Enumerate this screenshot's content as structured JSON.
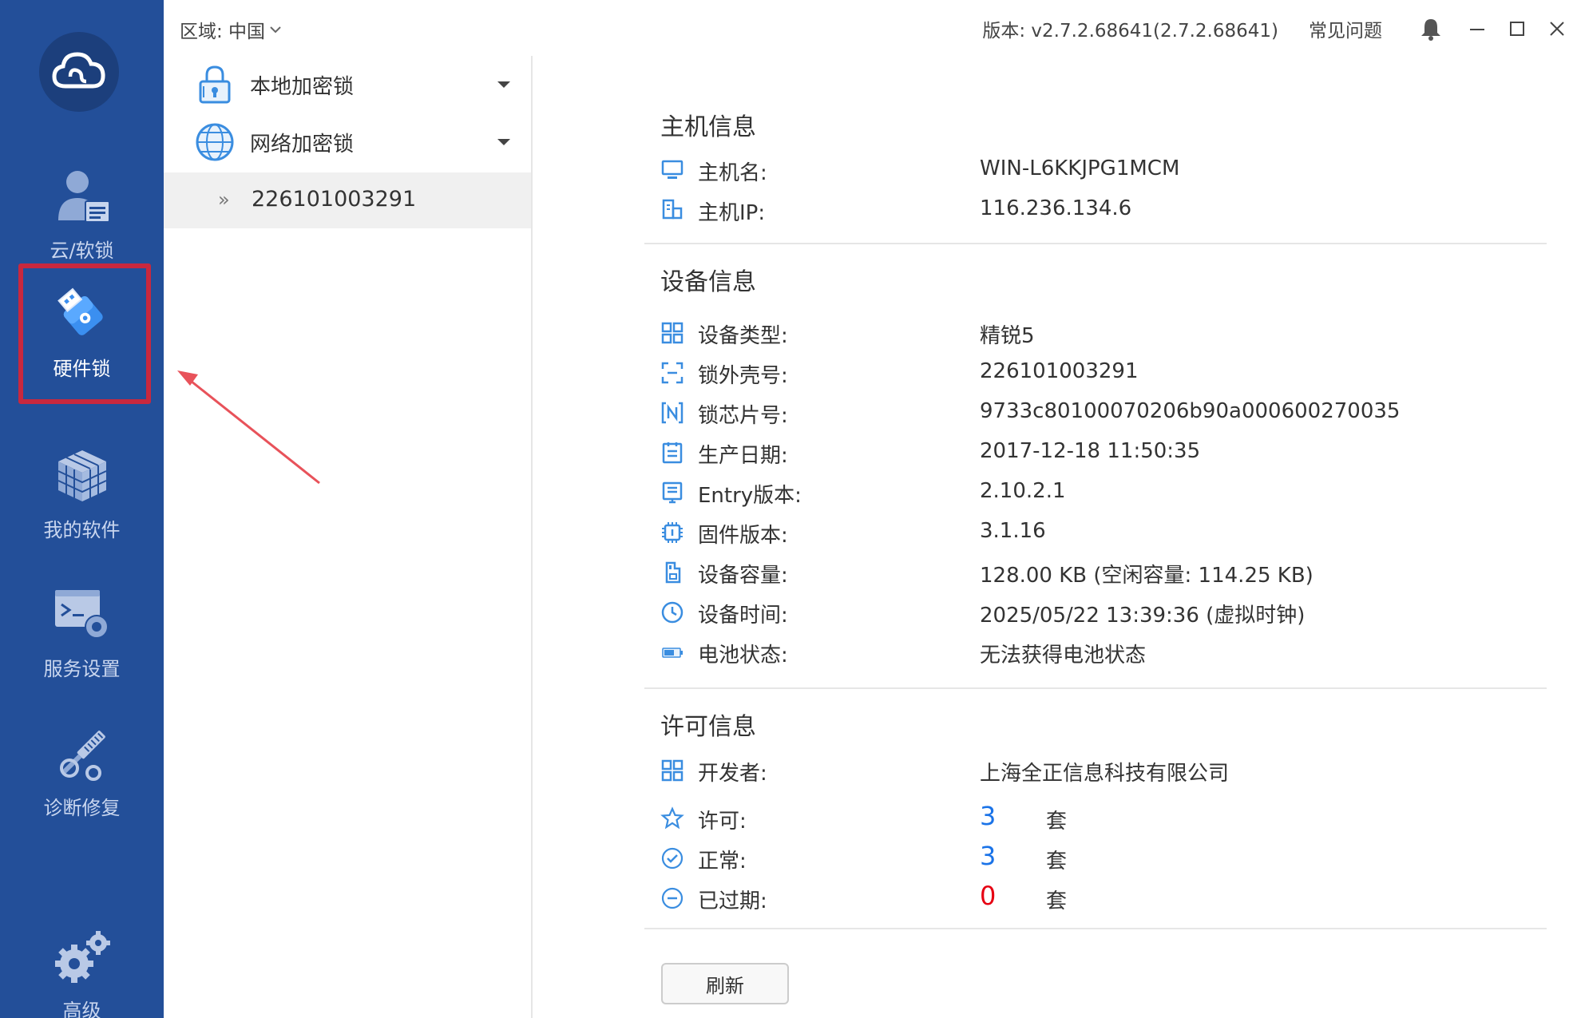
{
  "colors": {
    "sidebar_bg": "#234f99",
    "highlight_border": "#c8283e",
    "accent_blue": "#1a73e8",
    "danger_red": "#e60012",
    "icon_blue": "#3a8de0"
  },
  "sidebar": {
    "logo_icon": "cloud-logo-icon",
    "items": [
      {
        "label": "云/软锁",
        "icon": "user-doc-icon"
      },
      {
        "label": "硬件锁",
        "icon": "usb-key-icon",
        "active": true
      },
      {
        "label": "我的软件",
        "icon": "cube-icon"
      },
      {
        "label": "服务设置",
        "icon": "terminal-gear-icon"
      },
      {
        "label": "诊断修复",
        "icon": "tool-icon"
      },
      {
        "label": "高级",
        "icon": "gears-icon"
      }
    ]
  },
  "topbar": {
    "region_label": "区域: 中国",
    "version": "版本: v2.7.2.68641(2.7.2.68641)",
    "faq": "常见问题"
  },
  "tree": {
    "groups": [
      {
        "label": "本地加密锁",
        "icon": "padlock-icon"
      },
      {
        "label": "网络加密锁",
        "icon": "globe-icon"
      }
    ],
    "selected_device": "226101003291"
  },
  "host_info": {
    "title": "主机信息",
    "rows": [
      {
        "label": "主机名:",
        "value": "WIN-L6KKJPG1MCM",
        "icon": "monitor-icon"
      },
      {
        "label": "主机IP:",
        "value": "116.236.134.6",
        "icon": "network-icon"
      }
    ]
  },
  "device_info": {
    "title": "设备信息",
    "rows": [
      {
        "label": "设备类型:",
        "value": "精锐5",
        "icon": "grid-icon"
      },
      {
        "label": "锁外壳号:",
        "value": "226101003291",
        "icon": "scan-icon"
      },
      {
        "label": "锁芯片号:",
        "value": "9733c80100070206b90a000600270035",
        "icon": "nfc-icon"
      },
      {
        "label": "生产日期:",
        "value": "2017-12-18 11:50:35",
        "icon": "calendar-icon"
      },
      {
        "label": "Entry版本:",
        "value": "2.10.2.1",
        "icon": "document-icon"
      },
      {
        "label": "固件版本:",
        "value": "3.1.16",
        "icon": "chip-icon"
      },
      {
        "label": "设备容量:",
        "value": "128.00 KB (空闲容量: 114.25 KB)",
        "icon": "storage-icon"
      },
      {
        "label": "设备时间:",
        "value": "2025/05/22 13:39:36 (虚拟时钟)",
        "icon": "clock-icon"
      },
      {
        "label": "电池状态:",
        "value": "无法获得电池状态",
        "icon": "battery-icon"
      }
    ]
  },
  "license_info": {
    "title": "许可信息",
    "developer_label": "开发者:",
    "developer_value": "上海全正信息科技有限公司",
    "counts": [
      {
        "label": "许可:",
        "value": "3",
        "unit": "套",
        "icon": "star-icon",
        "color": "#1a73e8"
      },
      {
        "label": "正常:",
        "value": "3",
        "unit": "套",
        "icon": "check-circle-icon",
        "color": "#1a73e8"
      },
      {
        "label": "已过期:",
        "value": "0",
        "unit": "套",
        "icon": "minus-circle-icon",
        "color": "#e60012"
      }
    ]
  },
  "refresh_label": "刷新"
}
